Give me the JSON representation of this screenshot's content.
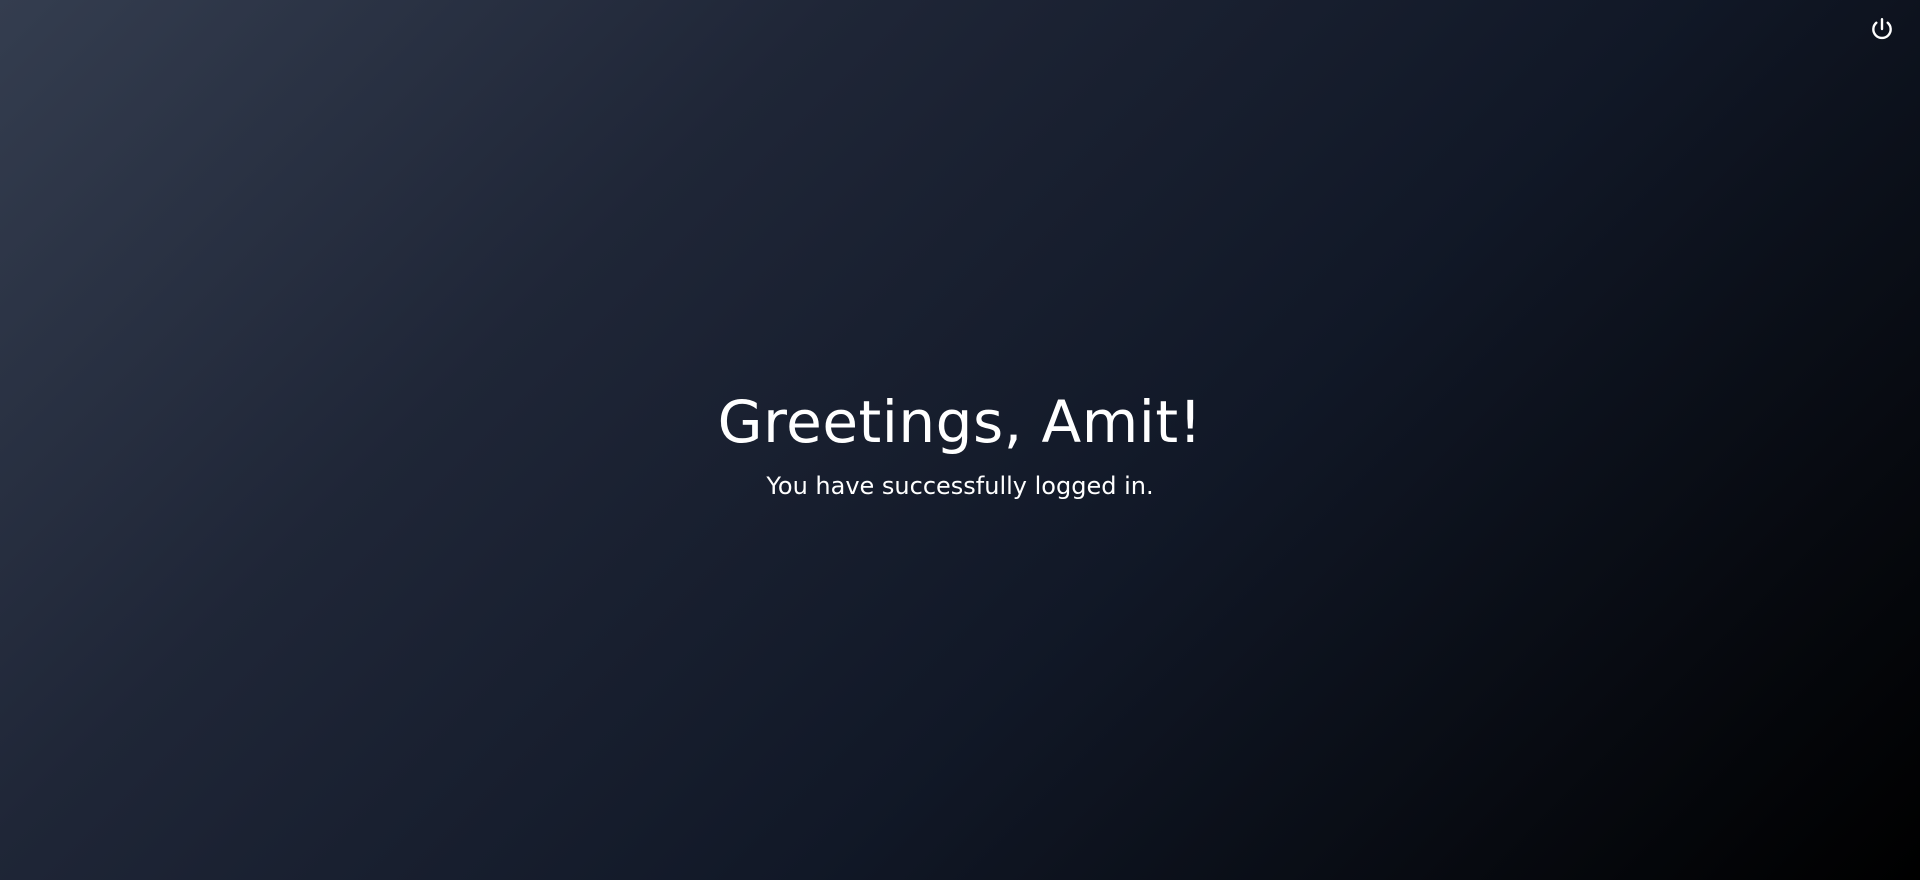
{
  "header": {
    "logout_icon": "power-icon"
  },
  "main": {
    "greeting": "Greetings, Amit!",
    "subtitle": "You have successfully logged in."
  },
  "colors": {
    "background_start": "#343d4f",
    "background_end": "#000000",
    "text": "#ffffff"
  }
}
